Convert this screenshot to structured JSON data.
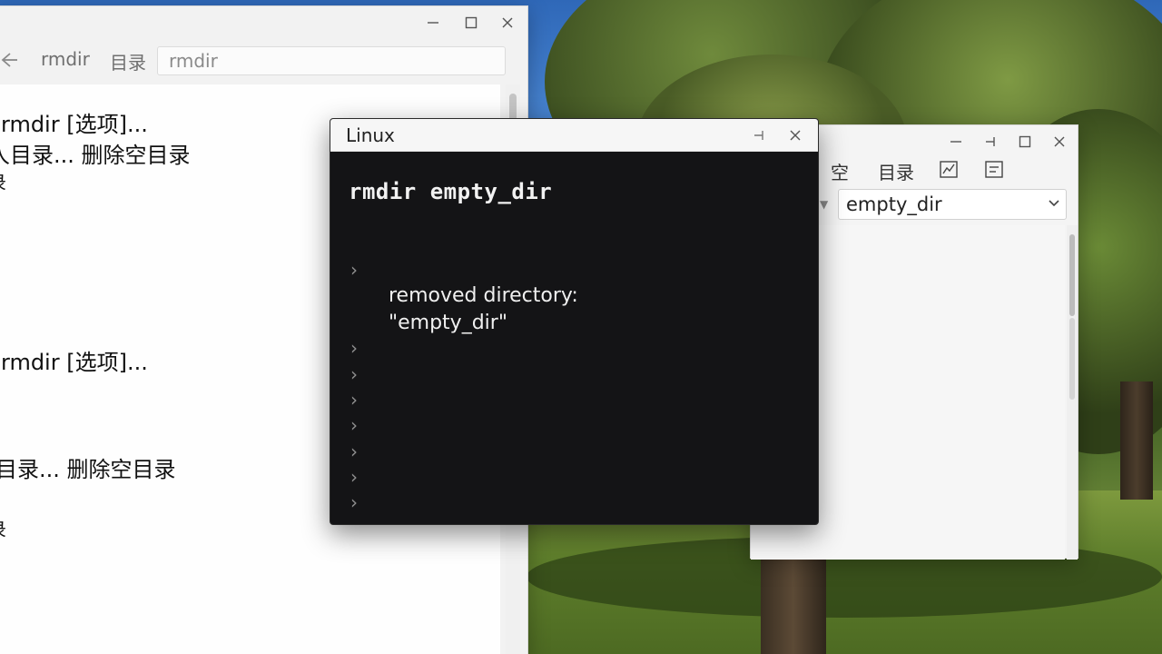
{
  "left_window": {
    "toolbar": {
      "back_icon": "back-arrow-icon",
      "command_label": "rmdir",
      "category_label": "目录",
      "search_value": "rmdir"
    },
    "content_lines": [
      "rmdir  [选项]...",
      "人目录... 删除空目录",
      "录",
      "rmdir  [选项]...",
      "目录...  删除空目录",
      "录"
    ]
  },
  "terminal": {
    "title": "Linux",
    "command": "rmdir empty_dir",
    "output_line1": "removed directory:",
    "output_line2": "\"empty_dir\"",
    "prompt_glyph": "›"
  },
  "right_window": {
    "toolbar": {
      "item1": "空",
      "item2": "目录",
      "icon1": "chart-icon",
      "icon2": "dashboard-icon"
    },
    "path_value": "empty_dir"
  }
}
